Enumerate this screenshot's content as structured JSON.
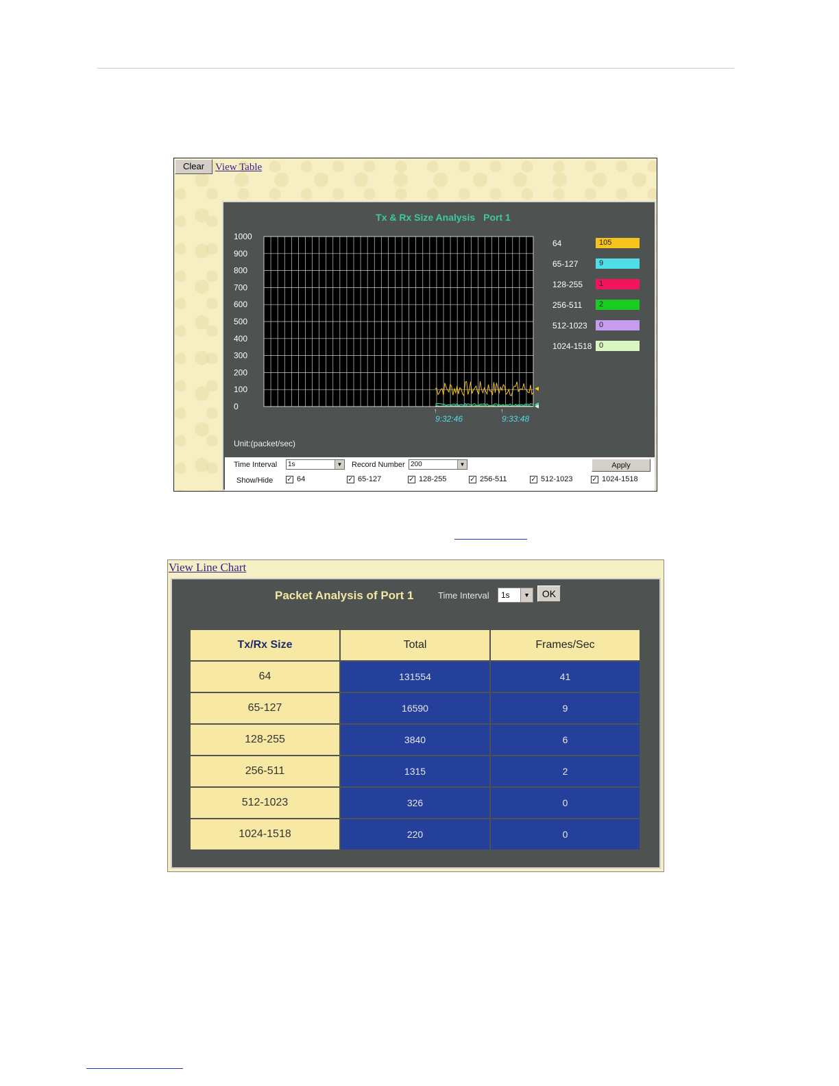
{
  "chart_panel": {
    "clear_label": "Clear",
    "view_table_label": "View Table",
    "unit_label": "Unit:(packet/sec)",
    "controls": {
      "time_interval_label": "Time Interval",
      "time_interval_value": "1s",
      "record_number_label": "Record Number",
      "record_number_value": "200",
      "apply_label": "Apply",
      "show_hide_label": "Show/Hide",
      "checkboxes": [
        "64",
        "65-127",
        "128-255",
        "256-511",
        "512-1023",
        "1024-1518"
      ]
    }
  },
  "chart_data": {
    "type": "line",
    "title": "Tx & Rx Size Analysis",
    "title_port": "Port 1",
    "ylim": [
      0,
      1000
    ],
    "yticks": [
      "1000",
      "900",
      "800",
      "700",
      "600",
      "500",
      "400",
      "300",
      "200",
      "100",
      "0"
    ],
    "x_time_labels": [
      "9:32:46",
      "9:33:48"
    ],
    "grid": true,
    "legend_placement": "right",
    "series": [
      {
        "name": "64",
        "current": "105",
        "color": "#f5c31c",
        "level": 105,
        "noise": 45
      },
      {
        "name": "65-127",
        "current": "9",
        "color": "#4fdde8",
        "level": 12,
        "noise": 6
      },
      {
        "name": "128-255",
        "current": "1",
        "color": "#f2155c",
        "level": 3,
        "noise": 2
      },
      {
        "name": "256-511",
        "current": "2",
        "color": "#18cc22",
        "level": 5,
        "noise": 3
      },
      {
        "name": "512-1023",
        "current": "0",
        "color": "#c79cf0",
        "level": 1,
        "noise": 1
      },
      {
        "name": "1024-1518",
        "current": "0",
        "color": "#daf7c2",
        "level": 1,
        "noise": 1
      }
    ]
  },
  "table_panel": {
    "view_line_chart_label": "View Line Chart",
    "title": "Packet Analysis of Port 1",
    "time_interval_label": "Time Interval",
    "time_interval_value": "1s",
    "ok_label": "OK",
    "headers": [
      "Tx/Rx Size",
      "Total",
      "Frames/Sec"
    ],
    "rows": [
      [
        "64",
        "131554",
        "41"
      ],
      [
        "65-127",
        "16590",
        "9"
      ],
      [
        "128-255",
        "3840",
        "6"
      ],
      [
        "256-511",
        "1315",
        "2"
      ],
      [
        "512-1023",
        "326",
        "0"
      ],
      [
        "1024-1518",
        "220",
        "0"
      ]
    ]
  }
}
